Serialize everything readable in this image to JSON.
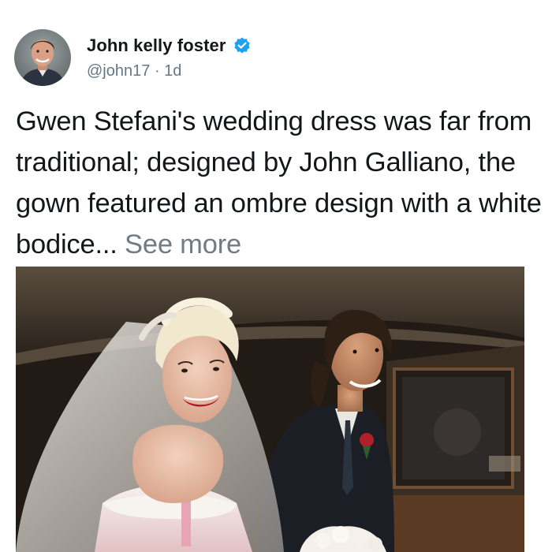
{
  "post": {
    "author": {
      "display_name": "John kelly foster",
      "handle": "@john17",
      "separator": "·",
      "time_ago": "1d",
      "verified": true,
      "avatar_icon": "user-avatar-photo",
      "verified_icon": "verified-badge-icon"
    },
    "text": "Gwen Stefani's wedding dress was far from traditional; designed by John Galliano, the gown featured an ombre design with a white bodice...",
    "see_more_label": "See more",
    "media": {
      "type": "photo",
      "photo_icon": "wedding-photo"
    }
  },
  "colors": {
    "text_primary": "#14171a",
    "text_secondary": "#657786",
    "see_more": "#707b84",
    "verified_blue": "#1da1f2",
    "background": "#ffffff"
  }
}
